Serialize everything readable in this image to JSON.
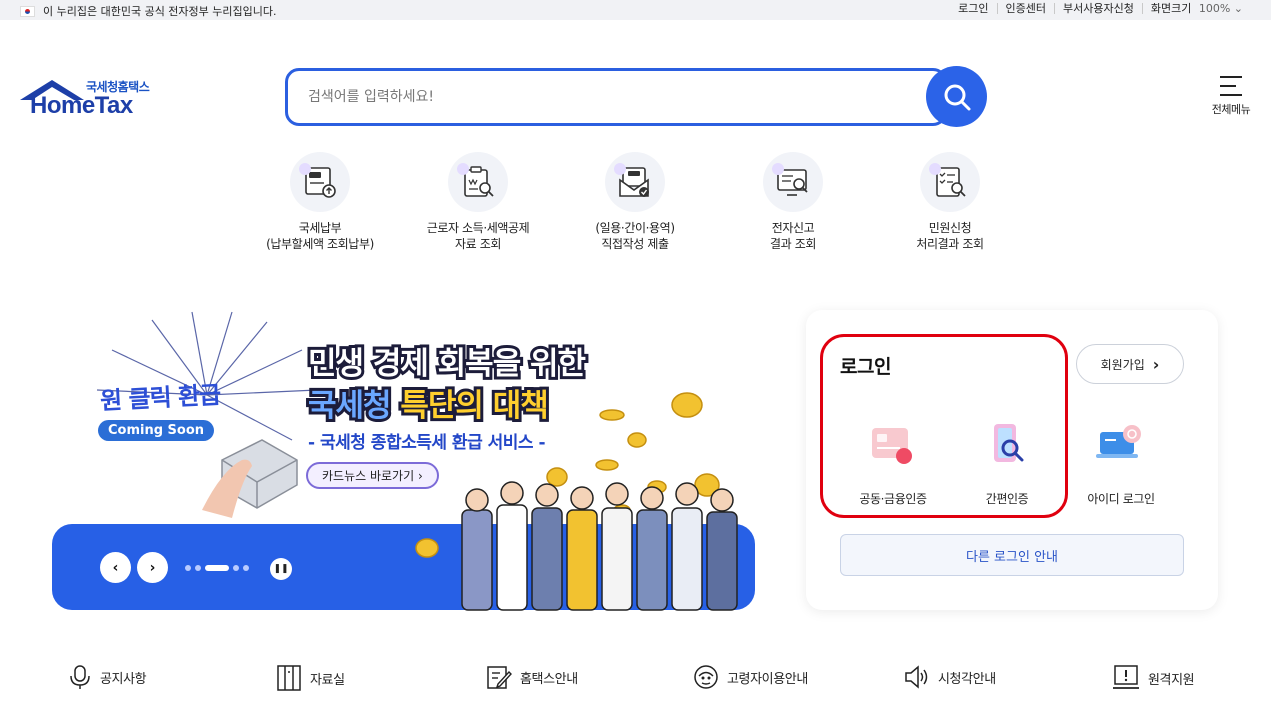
{
  "gov_bar": {
    "notice": "이 누리집은 대한민국 공식 전자정부 누리집입니다.",
    "links": [
      "로그인",
      "인증센터",
      "부서사용자신청"
    ],
    "zoom_label": "화면크기",
    "zoom_value": "100%"
  },
  "logo": {
    "korean": "국세청홈택스",
    "english": "HomeTax"
  },
  "search": {
    "placeholder": "검색어를 입력하세요!"
  },
  "full_menu": {
    "label": "전체메뉴"
  },
  "quick_services": [
    {
      "label": "국세납부\n(납부할세액 조회납부)",
      "icon": "tax-payment-icon"
    },
    {
      "label": "근로자 소득·세액공제\n자료 조회",
      "icon": "income-deduction-icon"
    },
    {
      "label": "(일용·간이·용역)\n직접작성 제출",
      "icon": "tax-envelope-icon"
    },
    {
      "label": "전자신고\n결과 조회",
      "icon": "e-filing-result-icon"
    },
    {
      "label": "민원신청\n처리결과 조회",
      "icon": "civil-petition-icon"
    }
  ],
  "banner": {
    "badge": "원 클릭 환급",
    "coming_soon": "Coming Soon",
    "headline_line1": "민생 경제 회복을 위한",
    "headline_line2_accent": "국세청",
    "headline_line2_rest": " 특단의 대책",
    "subline": "- 국세청 종합소득세 환급 서비스 -",
    "cardnews_button": "카드뉴스 바로가기",
    "slide_count": 5,
    "active_slide": 3
  },
  "login": {
    "title": "로그인",
    "join_button": "회원가입",
    "options": [
      {
        "label": "공동·금융인증",
        "icon": "certificate-icon"
      },
      {
        "label": "간편인증",
        "icon": "simple-auth-icon"
      },
      {
        "label": "아이디 로그인",
        "icon": "id-login-icon"
      }
    ],
    "other_login": "다른 로그인 안내",
    "highlight_color": "#e0000f"
  },
  "bottom_nav": [
    {
      "label": "공지사항",
      "icon": "microphone-icon"
    },
    {
      "label": "자료실",
      "icon": "archive-icon"
    },
    {
      "label": "홈택스안내",
      "icon": "guide-icon"
    },
    {
      "label": "고령자이용안내",
      "icon": "senior-icon"
    },
    {
      "label": "시청각안내",
      "icon": "speaker-icon"
    },
    {
      "label": "원격지원",
      "icon": "remote-support-icon"
    }
  ],
  "colors": {
    "primary": "#2b63e8",
    "logo_blue": "#1d3fa8",
    "banner_blue": "#2760e6"
  }
}
